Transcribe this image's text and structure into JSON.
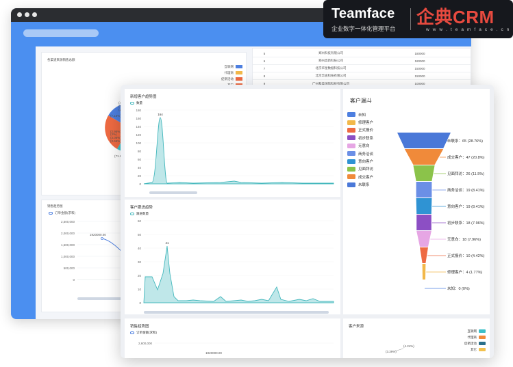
{
  "brand": {
    "name": "Teamface",
    "tagline": "企业数字一体化管理平台",
    "product": "企典CRM",
    "url": "w w w . t e a m f a c e . c n"
  },
  "back_window": {
    "source_sales_title": "各渠道来源销售总额",
    "source_legend": [
      "互联网",
      "代理商",
      "促销活动",
      "其它"
    ],
    "pie_labels": [
      "(4.1%)",
      "(3.82%)",
      "(2.49%)",
      "(7.16%)",
      "(2.95%)",
      "(3%)",
      "(3.06%)",
      "(3.65%)",
      "(71.6%)"
    ],
    "table_rows": [
      {
        "no": "5",
        "name": "郑州科技有限公司",
        "amount": "180000"
      },
      {
        "no": "6",
        "name": "郑州高新科技公司",
        "amount": "180000"
      },
      {
        "no": "7",
        "name": "北京华星数据科技公司",
        "amount": "150000"
      },
      {
        "no": "8",
        "name": "北京华迪科技有限公司",
        "amount": "150000"
      },
      {
        "no": "9",
        "name": "广州和美国际科技有限公司",
        "amount": "100000"
      }
    ],
    "sales_trend_title": "销售趋势图",
    "sales_trend_legend": "订单金额(求和)",
    "y_ticks": [
      "2,500,000",
      "2,000,000",
      "1,500,000",
      "1,000,000",
      "500,000",
      "0"
    ],
    "point_label": "1920000.00"
  },
  "new_customer_chart": {
    "title": "新增客户趋势图",
    "legend": "数量",
    "y_ticks": [
      "180",
      "160",
      "140",
      "120",
      "100",
      "80",
      "60",
      "40",
      "20",
      "0"
    ],
    "peak_label": "164"
  },
  "follow_chart": {
    "title": "客户跟进趋势",
    "legend": "跟进数量",
    "y_ticks": [
      "60",
      "50",
      "40",
      "30",
      "20",
      "10",
      "0"
    ],
    "peak_label": "41"
  },
  "funnel": {
    "title": "客户漏斗",
    "legend": [
      {
        "name": "未知",
        "color": "#4d7fe0"
      },
      {
        "name": "修理客户",
        "color": "#f2b84a"
      },
      {
        "name": "正式报价",
        "color": "#ee6a42"
      },
      {
        "name": "初步联系",
        "color": "#8c4fc4"
      },
      {
        "name": "无意向",
        "color": "#e6a6e4"
      },
      {
        "name": "商务洽谈",
        "color": "#6b8fe6"
      },
      {
        "name": "意向客户",
        "color": "#2f93d3"
      },
      {
        "name": "见面拜访",
        "color": "#8bc34a"
      },
      {
        "name": "成交客户",
        "color": "#f08a3a"
      },
      {
        "name": "未联系",
        "color": "#4a78d8"
      }
    ],
    "stages": [
      {
        "label": "未联系：65 (28.76%)",
        "value": 65,
        "color": "#4a78d8"
      },
      {
        "label": "成交客户：47 (20.8%)",
        "value": 47,
        "color": "#f08a3a"
      },
      {
        "label": "见面拜访：26 (11.5%)",
        "value": 26,
        "color": "#8bc34a"
      },
      {
        "label": "商务洽谈：19 (8.41%)",
        "value": 19,
        "color": "#6b8fe6"
      },
      {
        "label": "意向客户：19 (8.41%)",
        "value": 19,
        "color": "#2f93d3"
      },
      {
        "label": "初步联系：18 (7.96%)",
        "value": 18,
        "color": "#8c4fc4"
      },
      {
        "label": "无意向：18 (7.96%)",
        "value": 18,
        "color": "#e6a6e4"
      },
      {
        "label": "正式报价：10 (4.42%)",
        "value": 10,
        "color": "#ee6a42"
      },
      {
        "label": "修理客户：4 (1.77%)",
        "value": 4,
        "color": "#f2b84a"
      },
      {
        "label": "未知：0 (0%)",
        "value": 0,
        "color": "#4d7fe0"
      }
    ]
  },
  "sales_trend_front": {
    "title": "销售趋势图",
    "legend": "订单金额(求和)",
    "y_top": "2,600,000",
    "point_label": "1920000.00"
  },
  "customer_source": {
    "title": "客户来源",
    "legend": [
      {
        "name": "互联网",
        "color": "#3cc0c8"
      },
      {
        "name": "代理商",
        "color": "#f08a3a"
      },
      {
        "name": "促销活动",
        "color": "#2b6f8a"
      },
      {
        "name": "其它",
        "color": "#f2c14e"
      }
    ],
    "labels": [
      "(4.24%)",
      "(3.39%)"
    ]
  }
}
